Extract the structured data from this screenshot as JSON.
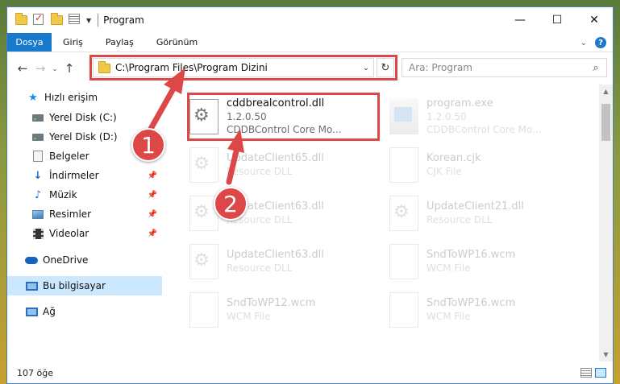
{
  "window": {
    "title": "Program"
  },
  "ribbon": {
    "tabs": [
      "Dosya",
      "Giriş",
      "Paylaş",
      "Görünüm"
    ]
  },
  "nav": {
    "address": "C:\\Program Files\\Program Dizini",
    "search_placeholder": "Ara: Program"
  },
  "sidebar": {
    "items": [
      {
        "label": "Hızlı erişim",
        "icon": "star-icon"
      },
      {
        "label": "Yerel Disk (C:)",
        "icon": "drive-icon"
      },
      {
        "label": "Yerel Disk (D:)",
        "icon": "drive-icon"
      },
      {
        "label": "Belgeler",
        "icon": "documents-icon"
      },
      {
        "label": "İndirmeler",
        "icon": "download-icon"
      },
      {
        "label": "Müzik",
        "icon": "music-icon"
      },
      {
        "label": "Resimler",
        "icon": "pictures-icon"
      },
      {
        "label": "Videolar",
        "icon": "videos-icon"
      },
      {
        "label": "OneDrive",
        "icon": "cloud-icon"
      },
      {
        "label": "Bu bilgisayar",
        "icon": "computer-icon"
      },
      {
        "label": "Ağ",
        "icon": "network-icon"
      }
    ]
  },
  "files": [
    {
      "name": "cddbrealcontrol.dll",
      "line2": "1.2.0.50",
      "line3": "CDDBControl Core Mo...",
      "icon": "dll-gear-icon"
    },
    {
      "name": "program.exe",
      "line2": "1.2.0.50",
      "line3": "CDDBControl Core Mo...",
      "icon": "exe-icon"
    },
    {
      "name": "UpdateClient65.dll",
      "line2": "Resource DLL",
      "icon": "dll-gear-icon"
    },
    {
      "name": "Korean.cjk",
      "line2": "CJK File",
      "icon": "file-icon"
    },
    {
      "name": "UpdateClient63.dll",
      "line2": "Resource DLL",
      "icon": "dll-gear-icon"
    },
    {
      "name": "UpdateClient21.dll",
      "line2": "Resource DLL",
      "icon": "dll-gear-icon"
    },
    {
      "name": "UpdateClient63.dll",
      "line2": "Resource DLL",
      "icon": "dll-gear-icon"
    },
    {
      "name": "SndToWP16.wcm",
      "line2": "WCM File",
      "icon": "file-icon"
    },
    {
      "name": "SndToWP12.wcm",
      "line2": "WCM File",
      "icon": "file-icon"
    },
    {
      "name": "SndToWP16.wcm",
      "line2": "WCM File",
      "icon": "file-icon"
    }
  ],
  "status": {
    "count": "107 öğe"
  },
  "annotations": {
    "step1": "1",
    "step2": "2",
    "color": "#dd4747"
  }
}
